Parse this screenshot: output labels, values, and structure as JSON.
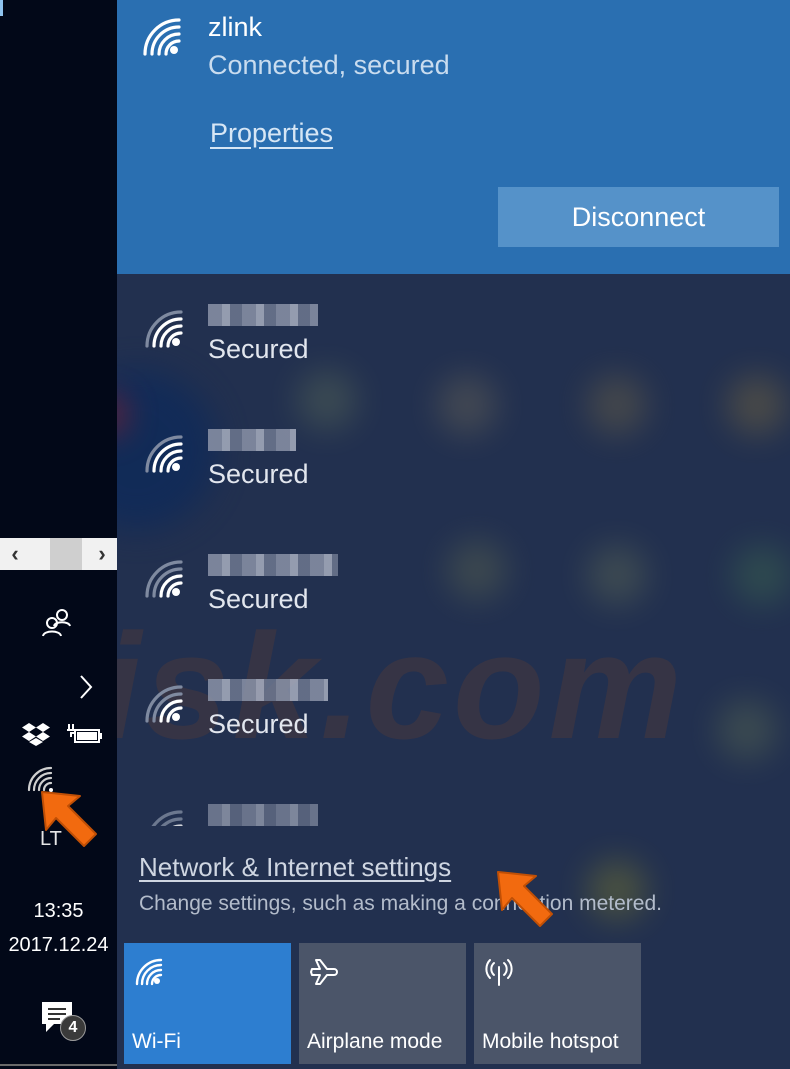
{
  "taskbar": {
    "scroll_left": "‹",
    "scroll_right": "›",
    "language": "LT",
    "time": "13:35",
    "date": "2017.12.24",
    "notification_count": "4"
  },
  "connected_network": {
    "name": "zlink",
    "status": "Connected, secured",
    "properties_label": "Properties",
    "disconnect_label": "Disconnect"
  },
  "networks": [
    {
      "ssid": "[redacted]",
      "status": "Secured",
      "signal": 4
    },
    {
      "ssid": "[redacted]",
      "status": "Secured",
      "signal": 4
    },
    {
      "ssid": "[redacted]",
      "status": "Secured",
      "signal": 2
    },
    {
      "ssid": "[redacted]",
      "status": "Secured",
      "signal": 2
    },
    {
      "ssid": "[redacted]",
      "status": "",
      "signal": 2
    }
  ],
  "settings": {
    "link_label": "Network & Internet settings",
    "description": "Change settings, such as making a connection metered."
  },
  "quick_actions": [
    {
      "label": "Wi-Fi",
      "icon": "wifi-icon",
      "active": true
    },
    {
      "label": "Airplane mode",
      "icon": "airplane-icon",
      "active": false
    },
    {
      "label": "Mobile hotspot",
      "icon": "hotspot-icon",
      "active": false
    }
  ],
  "watermark": "risk.com",
  "colors": {
    "accent": "#2a6fb1",
    "tile_active": "#2d7ed0",
    "tile_inactive": "#4b5569",
    "callout_arrow": "#f26a0f"
  }
}
